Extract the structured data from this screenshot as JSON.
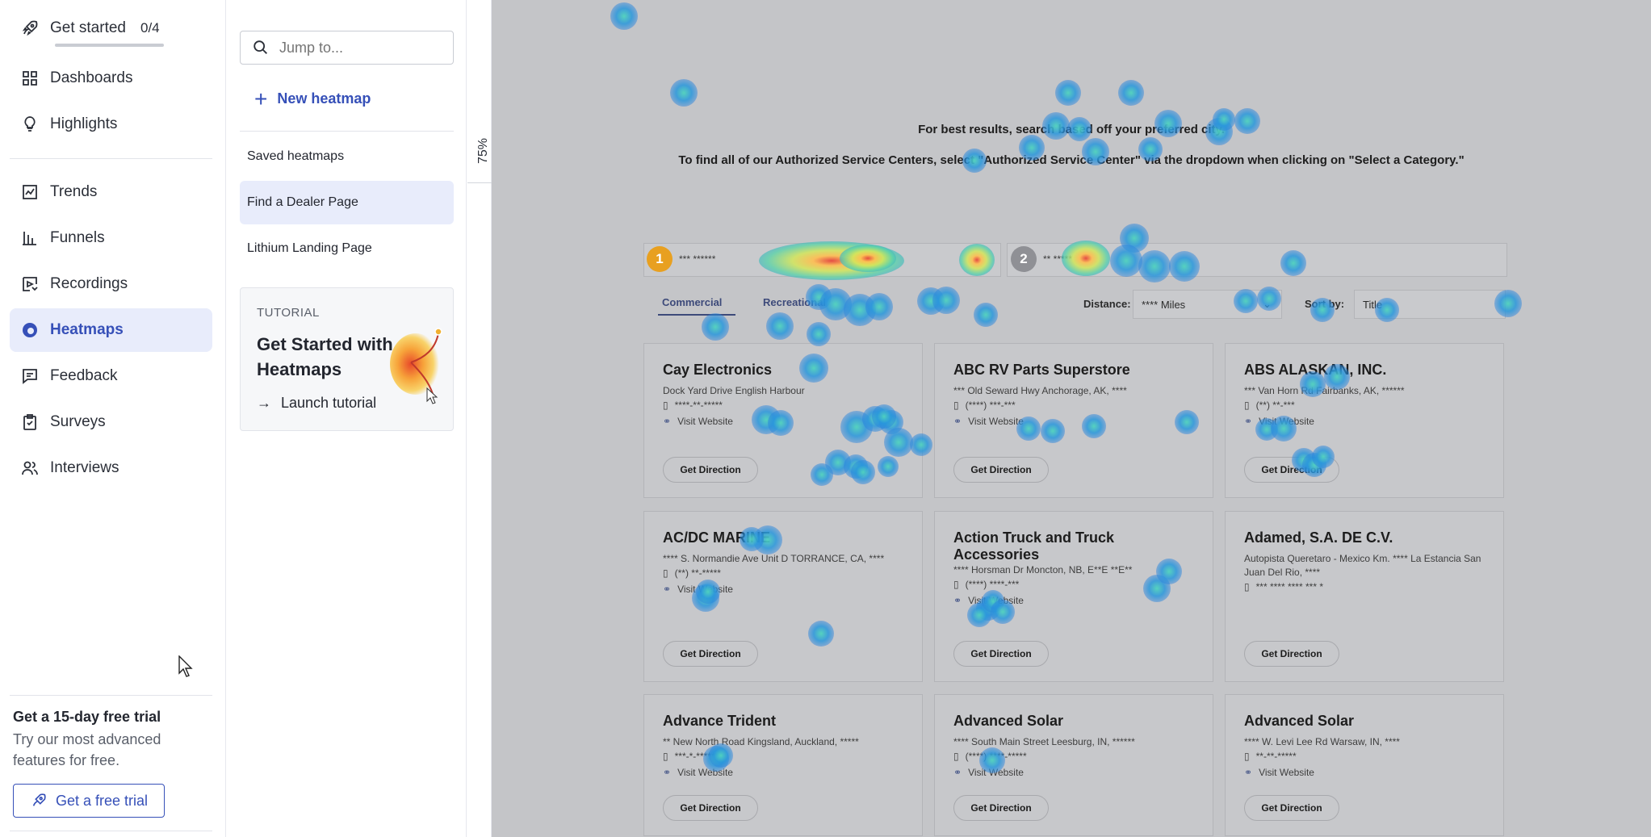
{
  "nav": {
    "get_started": {
      "label": "Get started",
      "count": "0/4"
    },
    "items": [
      {
        "label": "Dashboards",
        "icon": "dashboards-icon"
      },
      {
        "label": "Highlights",
        "icon": "lightbulb-icon"
      },
      {
        "label": "Trends",
        "icon": "trends-icon"
      },
      {
        "label": "Funnels",
        "icon": "funnels-icon"
      },
      {
        "label": "Recordings",
        "icon": "recordings-icon"
      },
      {
        "label": "Heatmaps",
        "icon": "heatmaps-icon",
        "active": true
      },
      {
        "label": "Feedback",
        "icon": "feedback-icon"
      },
      {
        "label": "Surveys",
        "icon": "surveys-icon"
      },
      {
        "label": "Interviews",
        "icon": "interviews-icon"
      }
    ],
    "trial": {
      "title": "Get a 15-day free trial",
      "subtitle": "Try our most advanced features for free.",
      "button": "Get a free trial"
    }
  },
  "panel": {
    "search_placeholder": "Jump to...",
    "new_heatmap": "New heatmap",
    "saved_heading": "Saved heatmaps",
    "saved_items": [
      "Find a Dealer Page",
      "Lithium Landing Page"
    ],
    "tutorial": {
      "tag": "TUTORIAL",
      "title": "Get Started with Heatmaps",
      "link": "Launch tutorial"
    }
  },
  "zoom": {
    "label": "75%"
  },
  "heatmap_page": {
    "intro_line1": "For best results, search based off your preferred city.",
    "intro_line2": "To find all of our Authorized Service Centers, select \"Authorized Service Center\" via the dropdown when clicking on \"Select a Category.\"",
    "search1_badge": "1",
    "search1_masked": "*** ******",
    "search2_badge": "2",
    "search2_masked": "** *****",
    "tabs": [
      "Commercial",
      "Recreational"
    ],
    "distance_label": "Distance:",
    "distance_value": "**** Miles",
    "sort_label": "Sort by:",
    "sort_value": "Title",
    "direction_label": "Get Direction",
    "dealers": [
      {
        "name": "Cay Electronics",
        "address": "Dock Yard Drive English Harbour",
        "phone": "****-**-*****",
        "website": "Visit Website"
      },
      {
        "name": "ABC RV Parts Superstore",
        "address": "*** Old Seward Hwy Anchorage, AK, ****",
        "phone": "(****) ***-***",
        "website": "Visit Website"
      },
      {
        "name": "ABS ALASKAN, INC.",
        "address": "*** Van Horn Rd Fairbanks, AK, ******",
        "phone": "(**) **-***",
        "website": "Visit Website"
      },
      {
        "name": "AC/DC MARINE",
        "address": "**** S. Normandie Ave Unit D TORRANCE, CA, ****",
        "phone": "(**) **-*****",
        "website": "Visit Website"
      },
      {
        "name": "Action Truck and Truck Accessories",
        "address": "**** Horsman Dr Moncton, NB, E**E **E**",
        "phone": "(****) ****-***",
        "website": "Visit Website"
      },
      {
        "name": "Adamed, S.A. DE C.V.",
        "address": "Autopista Queretaro - Mexico Km. **** La Estancia San Juan Del Rio, ****",
        "phone": "*** **** **** *** *",
        "website": ""
      },
      {
        "name": "Advance Trident",
        "address": "** New North Road Kingsland, Auckland, *****",
        "phone": "***-*-******",
        "website": "Visit Website"
      },
      {
        "name": "Advanced Solar",
        "address": "**** South Main Street Leesburg, IN, ******",
        "phone": "(****) ****-*****",
        "website": "Visit Website"
      },
      {
        "name": "Advanced Solar",
        "address": "**** W. Levi Lee Rd Warsaw, IN, ****",
        "phone": "**-**-*****",
        "website": "Visit Website"
      }
    ]
  },
  "colors": {
    "accent": "#3650b8",
    "active_bg": "#e8ecfb",
    "overlay": "#c4c5c8",
    "badge1": "#e8a020",
    "badge2": "#8f9095"
  }
}
